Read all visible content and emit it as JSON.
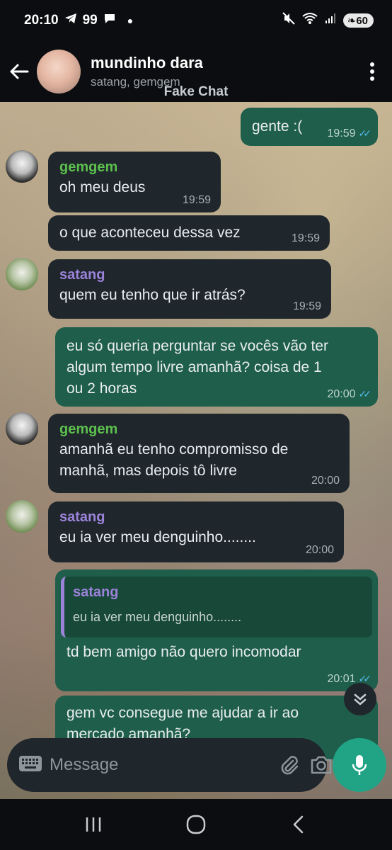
{
  "status_bar": {
    "time": "20:10",
    "notif_count": "99",
    "battery": "60"
  },
  "header": {
    "title": "mundinho dara",
    "subtitle": "satang, gemgem",
    "watermark": "Fake Chat"
  },
  "messages": [
    {
      "dir": "out",
      "text": "gente :(",
      "time": "19:59"
    },
    {
      "dir": "in",
      "sender": "gemgem",
      "text": "oh meu deus",
      "time": "19:59"
    },
    {
      "dir": "in",
      "text": "o que aconteceu dessa vez",
      "time": "19:59"
    },
    {
      "dir": "in",
      "sender": "satang",
      "text": "quem eu tenho que ir atrás?",
      "time": "19:59"
    },
    {
      "dir": "out",
      "lines": [
        "eu só queria perguntar se vocês vão ter",
        "algum tempo livre amanhã? coisa de 1",
        "ou 2 horas"
      ],
      "time": "20:00"
    },
    {
      "dir": "in",
      "sender": "gemgem",
      "lines": [
        "amanhã eu tenho compromisso de",
        "manhã, mas depois tô livre"
      ],
      "time": "20:00"
    },
    {
      "dir": "in",
      "sender": "satang",
      "text": "eu ia ver meu denguinho........",
      "time": "20:00"
    },
    {
      "dir": "out",
      "reply_sender": "satang",
      "reply_text": "eu ia ver meu denguinho........",
      "text": "td bem amigo não quero incomodar",
      "time": "20:01"
    },
    {
      "dir": "out",
      "lines": [
        "gem vc consegue me ajudar a ir ao",
        "mercado amanhã?"
      ]
    }
  ],
  "composer": {
    "placeholder": "Message"
  },
  "colors": {
    "incoming_bubble": "#1f262c",
    "outgoing_bubble": "#1f5e4b",
    "gemgem_name": "#5cc04d",
    "satang_name": "#9b83d9",
    "read_ticks": "#53bdeb",
    "mic_button": "#21a485"
  },
  "icons": [
    "back-arrow-icon",
    "more-vert-icon",
    "keyboard-icon",
    "attach-icon",
    "camera-icon",
    "mic-icon",
    "chevron-double-down-icon",
    "recents-icon",
    "home-icon",
    "back-icon"
  ]
}
